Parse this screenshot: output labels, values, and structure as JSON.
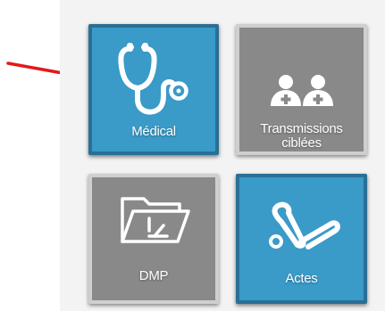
{
  "tiles": {
    "medical": {
      "label": "Médical",
      "icon": "stethoscope-icon",
      "color": "#3a9ac8"
    },
    "transmissions": {
      "label_line1": "Transmissions",
      "label_line2": "ciblées",
      "icon": "nurses-icon",
      "color": "#898989"
    },
    "dmp": {
      "label": "DMP",
      "icon": "folder-icon",
      "color": "#898989"
    },
    "actes": {
      "label": "Actes",
      "icon": "medical-instruments-icon",
      "color": "#3a9ac8"
    }
  },
  "annotation": {
    "icon": "red-arrow-icon",
    "color": "#e01b1b"
  }
}
